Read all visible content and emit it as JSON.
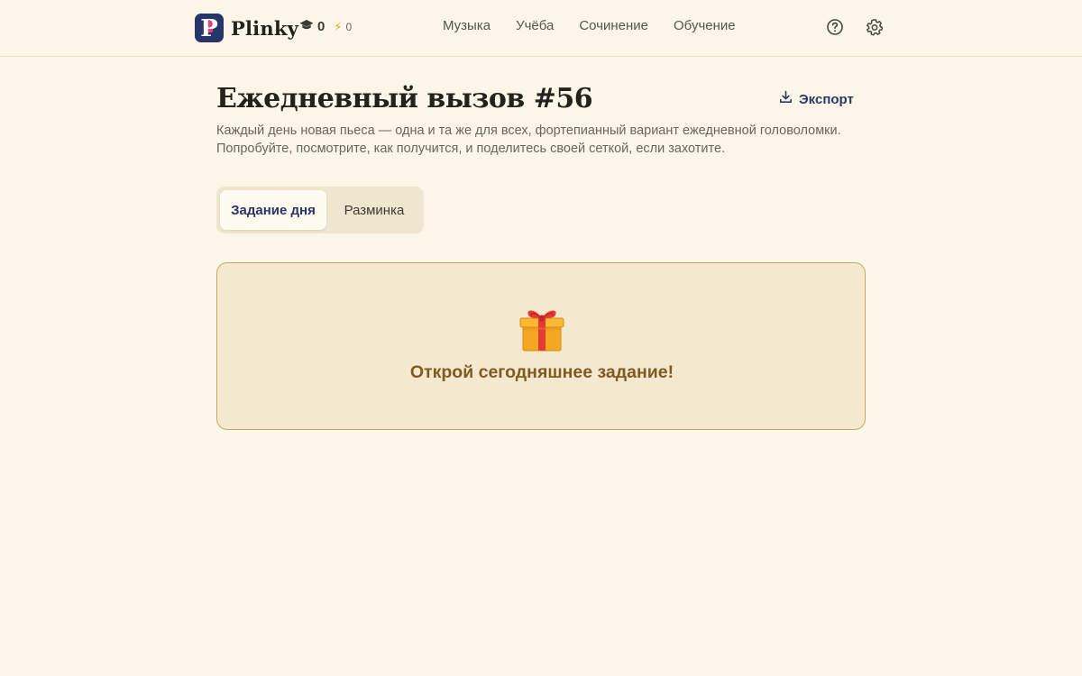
{
  "header": {
    "brand": {
      "letter": "P",
      "name": "Plinky"
    },
    "stats": {
      "learned": "0",
      "streak": "0"
    },
    "nav": [
      "Музыка",
      "Учёба",
      "Сочинение",
      "Обучение"
    ],
    "icons": {
      "help": "help-circle-icon",
      "settings": "gear-icon"
    }
  },
  "main": {
    "title": "Ежедневный вызов #56",
    "export_label": "Экспорт",
    "description": "Каждый день новая пьеса — одна и та же для всех, фортепианный вариант ежедневной головоломки. Попробуйте, посмотрите, как получится, и поделитесь своей сеткой, если захотите.",
    "tabs": [
      {
        "label": "Задание дня",
        "active": true
      },
      {
        "label": "Разминка",
        "active": false
      }
    ],
    "card": {
      "icon": "gift-icon",
      "text": "Открой сегодняшнее задание!"
    }
  },
  "colors": {
    "background": "#fcf6e9",
    "brand_navy": "#28356b",
    "card_bg": "#f4e8cf",
    "card_border": "#c9a864",
    "card_text": "#7f5a21"
  }
}
